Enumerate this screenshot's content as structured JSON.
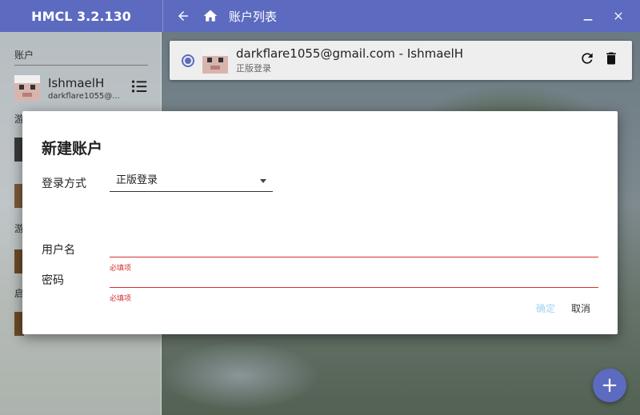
{
  "app": {
    "title": "HMCL 3.2.130"
  },
  "header": {
    "page_title": "账户列表",
    "icons": {
      "back": "arrow-left",
      "home": "home",
      "minimize": "minimize",
      "close": "close"
    }
  },
  "sidebar": {
    "section_accounts": "账户",
    "account": {
      "name": "IshmaelH",
      "email": "darkflare1055@..."
    },
    "stub_game_1": "游",
    "stub_game_2": "游",
    "stub_launch": "启"
  },
  "account_card": {
    "title": "darkflare1055@gmail.com - IshmaelH",
    "subtitle": "正版登录",
    "selected": true,
    "icons": {
      "refresh": "refresh",
      "delete": "trash"
    }
  },
  "dialog": {
    "title": "新建账户",
    "login_method_label": "登录方式",
    "login_method_value": "正版登录",
    "username_label": "用户名",
    "username_value": "",
    "username_error": "必填项",
    "password_label": "密码",
    "password_value": "",
    "password_error": "必填项",
    "ok_label": "确定",
    "cancel_label": "取消"
  },
  "fab": {
    "label": "+"
  },
  "colors": {
    "primary": "#5c6bc0",
    "error": "#d32f2f",
    "ok_disabled": "#9fd3f0"
  }
}
